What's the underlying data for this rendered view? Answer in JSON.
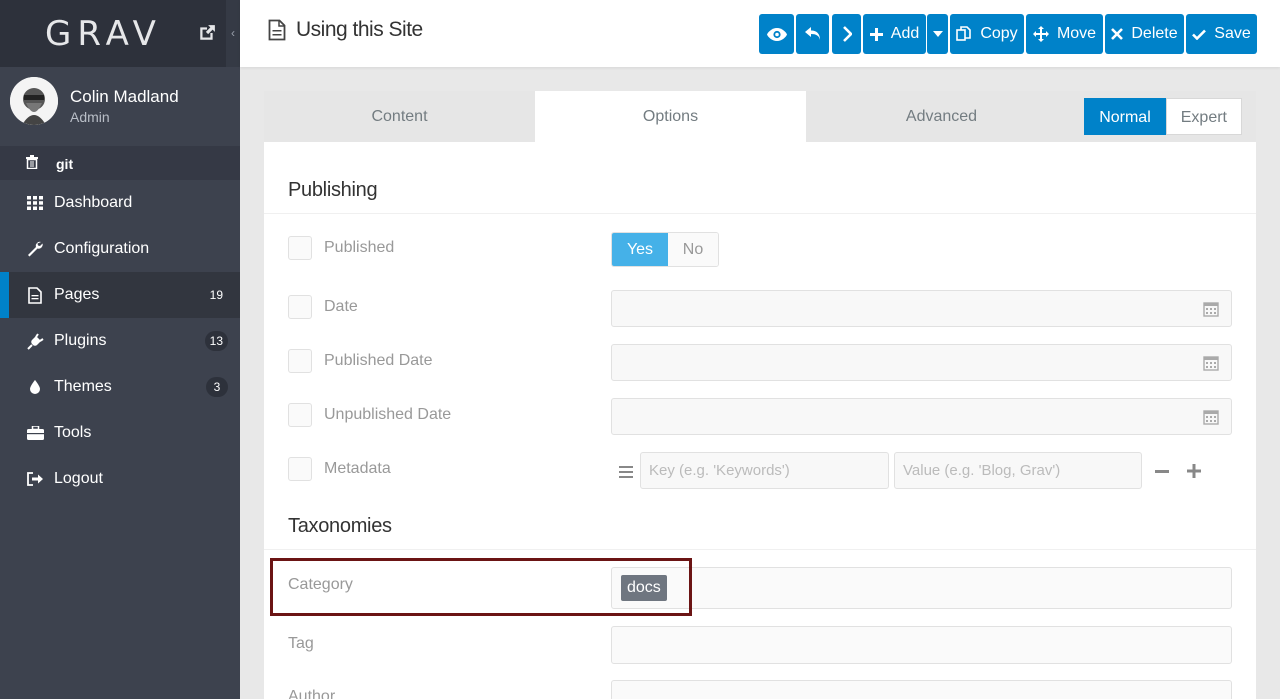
{
  "app": {
    "logo": "GRAV"
  },
  "user": {
    "name": "Colin Madland",
    "role": "Admin"
  },
  "sidebar": {
    "git_label": "git",
    "items": [
      {
        "label": "Dashboard",
        "icon": "grid-icon",
        "badge": ""
      },
      {
        "label": "Configuration",
        "icon": "wrench-icon",
        "badge": ""
      },
      {
        "label": "Pages",
        "icon": "file-icon",
        "badge": "19",
        "active": true
      },
      {
        "label": "Plugins",
        "icon": "plug-icon",
        "badge": "13"
      },
      {
        "label": "Themes",
        "icon": "tint-icon",
        "badge": "3"
      },
      {
        "label": "Tools",
        "icon": "briefcase-icon",
        "badge": ""
      },
      {
        "label": "Logout",
        "icon": "sign-out-icon",
        "badge": ""
      }
    ]
  },
  "topbar": {
    "title": "Using this Site",
    "buttons": {
      "add": "Add",
      "copy": "Copy",
      "move": "Move",
      "delete": "Delete",
      "save": "Save"
    }
  },
  "tabs": [
    "Content",
    "Options",
    "Advanced"
  ],
  "active_tab": "Options",
  "mode": {
    "normal": "Normal",
    "expert": "Expert",
    "selected": "Normal"
  },
  "publishing": {
    "title": "Publishing",
    "published": {
      "label": "Published",
      "yes": "Yes",
      "no": "No",
      "value": "Yes"
    },
    "date": {
      "label": "Date",
      "value": ""
    },
    "published_date": {
      "label": "Published Date",
      "value": ""
    },
    "unpublished_date": {
      "label": "Unpublished Date",
      "value": ""
    },
    "metadata": {
      "label": "Metadata",
      "key_placeholder": "Key (e.g. 'Keywords')",
      "value_placeholder": "Value (e.g. 'Blog, Grav')"
    }
  },
  "taxonomies": {
    "title": "Taxonomies",
    "category": {
      "label": "Category",
      "tags": [
        "docs"
      ]
    },
    "tag": {
      "label": "Tag",
      "tags": []
    },
    "author": {
      "label": "Author"
    }
  },
  "colors": {
    "accent": "#0082c9",
    "sidebar": "#3d424e",
    "highlight": "#6b1414"
  }
}
